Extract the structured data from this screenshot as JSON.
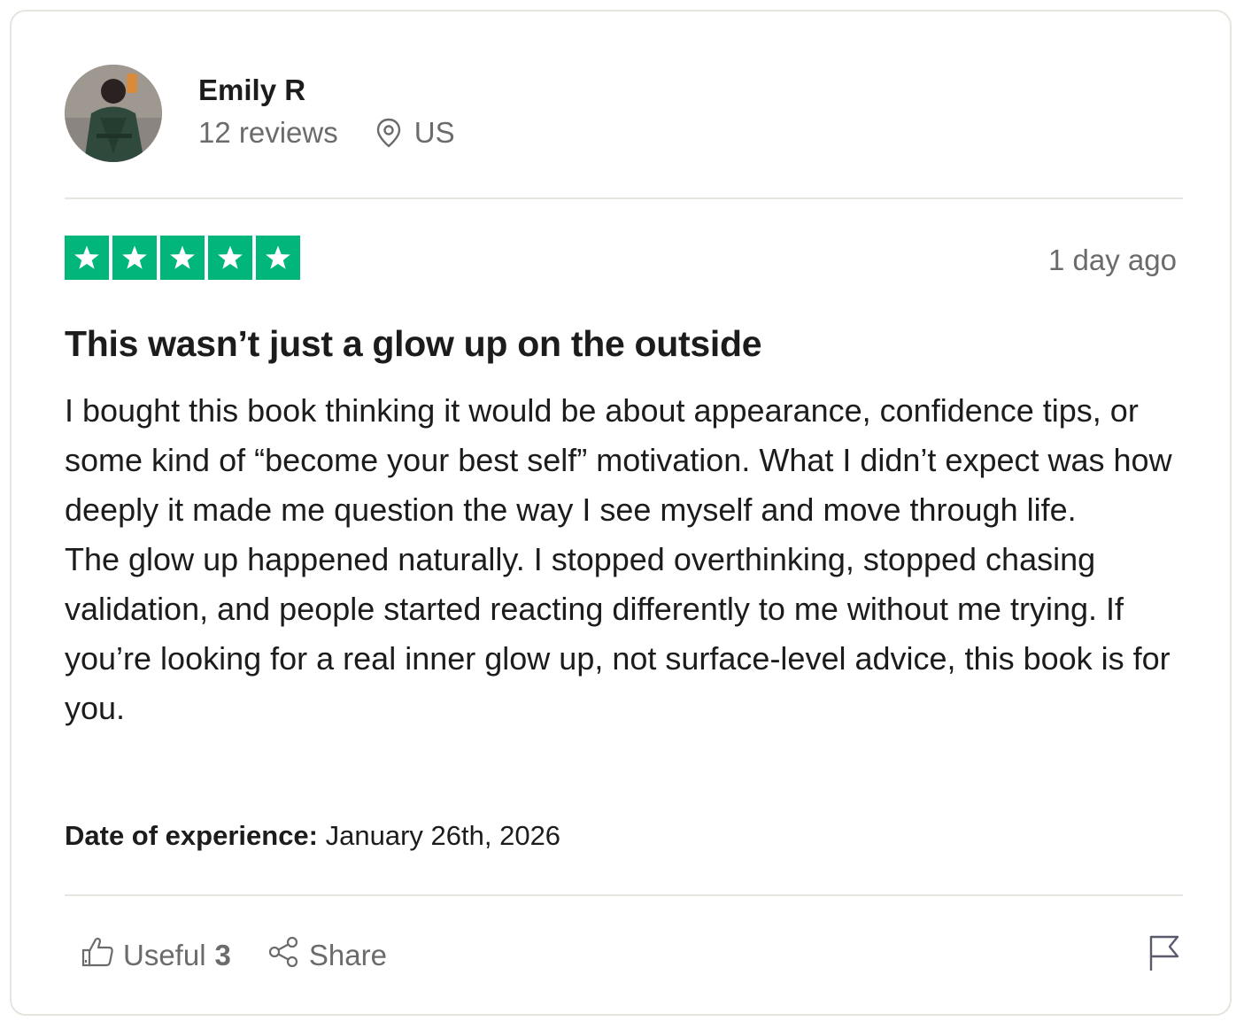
{
  "reviewer": {
    "name": "Emily R",
    "review_count": "12 reviews",
    "country": "US",
    "avatar_icon": "profile-photo"
  },
  "review": {
    "rating": 5,
    "max_rating": 5,
    "star_color": "#00b67a",
    "posted": "1 day ago",
    "title": "This wasn’t just a glow up on the outside",
    "paragraphs": [
      "I bought this book thinking it would be about appearance, confidence tips, or some kind of “become your best self” motivation. What I didn’t expect was how deeply it made me question the way I see myself and move through life.",
      "The glow up happened naturally. I stopped overthinking, stopped chasing validation, and people started reacting differently to me without me trying. If you’re looking for a real inner glow up, not surface-level advice, this book is for you."
    ],
    "experience_label": "Date of experience:",
    "experience_date": "January 26th, 2026"
  },
  "actions": {
    "useful_label": "Useful",
    "useful_count": "3",
    "share_label": "Share",
    "useful_icon": "thumbs-up-icon",
    "share_icon": "share-icon",
    "flag_icon": "flag-icon"
  }
}
